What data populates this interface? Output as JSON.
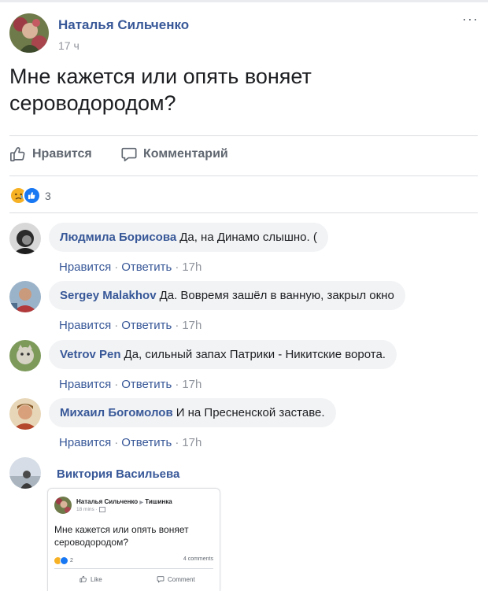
{
  "post": {
    "author": "Наталья Сильченко",
    "time": "17 ч",
    "more": "···",
    "text": "Мне кажется или опять воняет сероводородом?",
    "like_label": "Нравится",
    "comment_label": "Комментарий",
    "reaction_count": "3",
    "reaction_icons": [
      "sad-reaction-icon",
      "like-reaction-icon"
    ]
  },
  "comments": [
    {
      "author": "Людмила Борисова",
      "text": "Да, на Динамо слышно. (",
      "like": "Нравится",
      "reply": "Ответить",
      "time": "17h"
    },
    {
      "author": "Sergey Malakhov",
      "text": "Да. Вовремя зашёл в ванную, закрыл окно",
      "like": "Нравится",
      "reply": "Ответить",
      "time": "17h"
    },
    {
      "author": "Vetrov Pen",
      "text": "Да, сильный запах Патрики - Никитские ворота.",
      "like": "Нравится",
      "reply": "Ответить",
      "time": "17h"
    },
    {
      "author": "Михаил Богомолов",
      "text": "И на Пресненской заставе.",
      "like": "Нравится",
      "reply": "Ответить",
      "time": "17h"
    },
    {
      "author": "Виктория Васильева"
    }
  ],
  "attached_screenshot": {
    "author": "Наталья Сильченко",
    "arrow": "▶",
    "group": "Тишинка",
    "time": "18 mins ·",
    "text": "Мне кажется или опять воняет сероводородом?",
    "reaction_count": "2",
    "comments_count": "4 comments",
    "like_label": "Like",
    "comment_label": "Comment"
  },
  "colors": {
    "link": "#385898",
    "muted": "#606770",
    "bubble": "#f2f3f5",
    "like_blue": "#1877f2",
    "sad_yellow": "#f7b125"
  }
}
